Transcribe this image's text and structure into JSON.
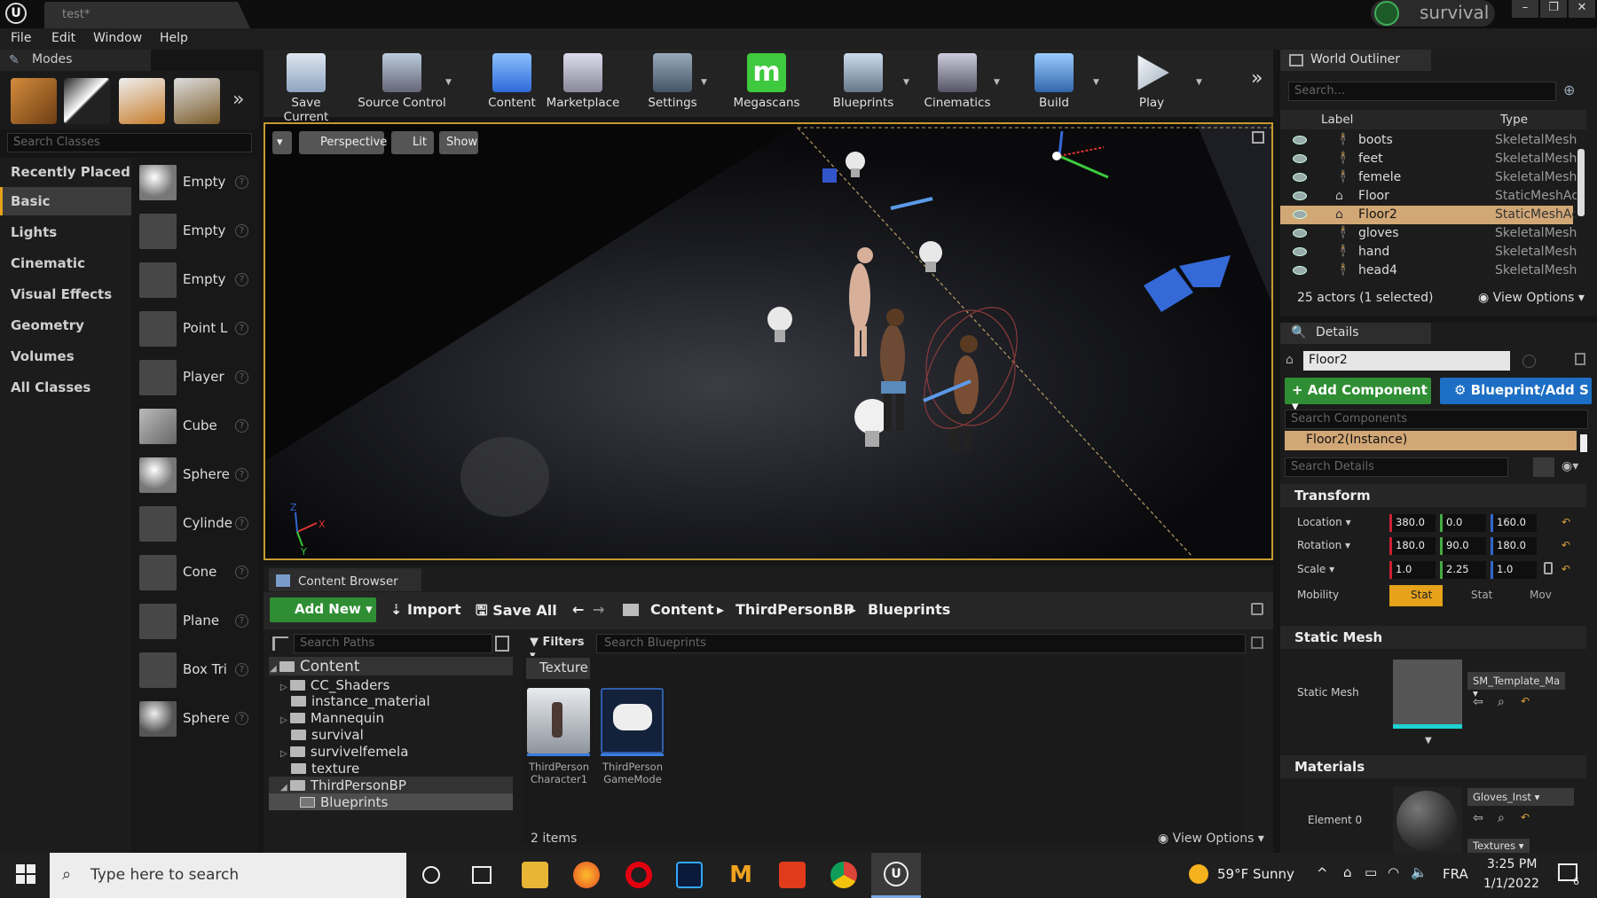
{
  "window": {
    "tab_title": "test*",
    "project": "survival"
  },
  "menu": [
    "File",
    "Edit",
    "Window",
    "Help"
  ],
  "modes": {
    "tab_label": "Modes",
    "search_placeholder": "Search Classes",
    "categories": [
      "Recently Placed",
      "Basic",
      "Lights",
      "Cinematic",
      "Visual Effects",
      "Geometry",
      "Volumes",
      "All Classes"
    ],
    "selected_category": "Basic",
    "items": [
      "Empty",
      "Empty",
      "Empty",
      "Point L",
      "Player",
      "Cube",
      "Sphere",
      "Cylinde",
      "Cone",
      "Plane",
      "Box Tri",
      "Sphere"
    ]
  },
  "toolbar": {
    "buttons": [
      "Save Current",
      "Source Control",
      "Content",
      "Marketplace",
      "Settings",
      "Megascans",
      "Blueprints",
      "Cinematics",
      "Build",
      "Play"
    ]
  },
  "viewport": {
    "perspective": "Perspective",
    "lit": "Lit",
    "show": "Show"
  },
  "content_browser": {
    "tab_label": "Content Browser",
    "add_new": "Add New",
    "import": "Import",
    "save_all": "Save All",
    "breadcrumb": [
      "Content",
      "ThirdPersonBP",
      "Blueprints"
    ],
    "search_paths_placeholder": "Search Paths",
    "filters": "Filters",
    "search_placeholder": "Search Blueprints",
    "filter_pill": "Texture",
    "tree": [
      "Content",
      "CC_Shaders",
      "instance_material",
      "Mannequin",
      "survival",
      "survivelfemela",
      "texture",
      "ThirdPersonBP",
      "Blueprints"
    ],
    "assets": [
      {
        "line1": "ThirdPerson",
        "line2": "Character1"
      },
      {
        "line1": "ThirdPerson",
        "line2": "GameMode"
      }
    ],
    "item_count": "2 items",
    "view_options": "View Options"
  },
  "outliner": {
    "tab_label": "World Outliner",
    "search_placeholder": "Search...",
    "col_label": "Label",
    "col_type": "Type",
    "rows": [
      {
        "name": "boots",
        "type": "SkeletalMesh"
      },
      {
        "name": "feet",
        "type": "SkeletalMesh"
      },
      {
        "name": "femele",
        "type": "SkeletalMesh"
      },
      {
        "name": "Floor",
        "type": "StaticMeshAc"
      },
      {
        "name": "Floor2",
        "type": "StaticMeshAc"
      },
      {
        "name": "gloves",
        "type": "SkeletalMesh"
      },
      {
        "name": "hand",
        "type": "SkeletalMesh"
      },
      {
        "name": "head4",
        "type": "SkeletalMesh"
      }
    ],
    "summary": "25 actors (1 selected)",
    "view_options": "View Options"
  },
  "details": {
    "tab_label": "Details",
    "object_name": "Floor2",
    "add_component": "+ Add Component",
    "blueprint_add": "Blueprint/Add S",
    "search_components": "Search Components",
    "instance": "Floor2(Instance)",
    "search_details": "Search Details",
    "transform_title": "Transform",
    "location_label": "Location",
    "rotation_label": "Rotation",
    "scale_label": "Scale",
    "mobility_label": "Mobility",
    "location": [
      "380.0",
      "0.0",
      "160.0"
    ],
    "rotation": [
      "180.0",
      "90.0",
      "180.0"
    ],
    "scale": [
      "1.0",
      "2.25",
      "1.0"
    ],
    "mobility_options": [
      "Stat",
      "Stat",
      "Mov"
    ],
    "static_mesh_title": "Static Mesh",
    "static_mesh_label": "Static Mesh",
    "static_mesh_value": "SM_Template_Ma",
    "materials_title": "Materials",
    "element0_label": "Element 0",
    "element0_value": "Gloves_Inst",
    "textures_label": "Textures"
  },
  "taskbar": {
    "search_placeholder": "Type here to search",
    "weather": "59°F  Sunny",
    "language": "FRA",
    "time": "3:25 PM",
    "date": "1/1/2022",
    "notifications": "6"
  }
}
